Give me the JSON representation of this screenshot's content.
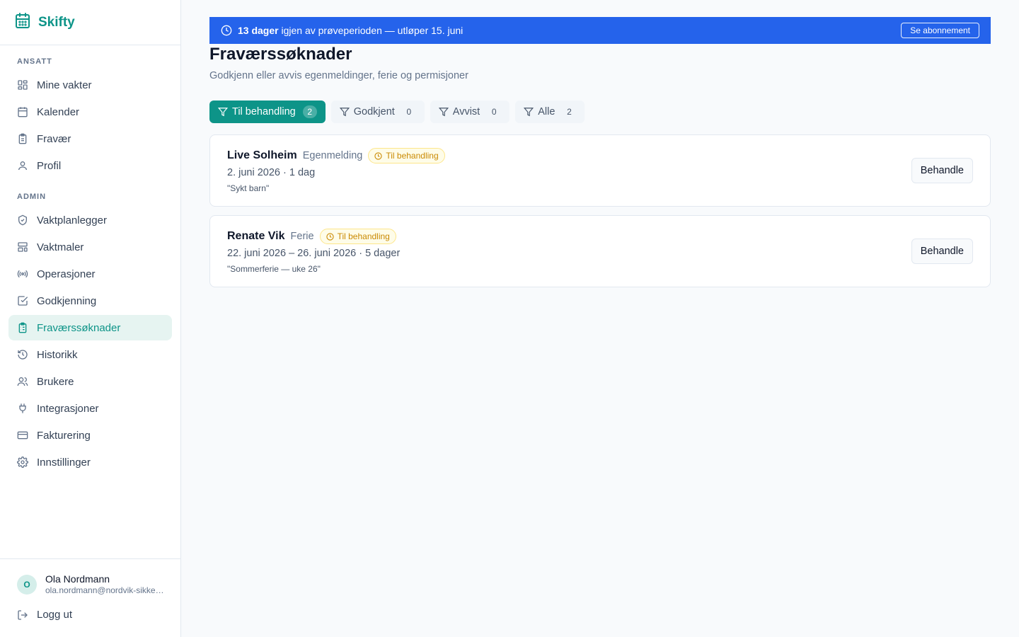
{
  "app": {
    "name": "Skifty"
  },
  "sidebar": {
    "ansatt_label": "ANSATT",
    "ansatt_items": [
      {
        "label": "Mine vakter",
        "icon": "layout-grid-icon"
      },
      {
        "label": "Kalender",
        "icon": "calendar-icon"
      },
      {
        "label": "Fravær",
        "icon": "clipboard-icon"
      },
      {
        "label": "Profil",
        "icon": "user-icon"
      }
    ],
    "admin_label": "ADMIN",
    "admin_items": [
      {
        "label": "Vaktplanlegger",
        "icon": "shield-icon"
      },
      {
        "label": "Vaktmaler",
        "icon": "template-icon"
      },
      {
        "label": "Operasjoner",
        "icon": "radio-icon"
      },
      {
        "label": "Godkjenning",
        "icon": "check-square-icon"
      },
      {
        "label": "Fraværssøknader",
        "icon": "clipboard-list-icon",
        "active": true
      },
      {
        "label": "Historikk",
        "icon": "history-icon"
      },
      {
        "label": "Brukere",
        "icon": "users-icon"
      },
      {
        "label": "Integrasjoner",
        "icon": "plug-icon"
      },
      {
        "label": "Fakturering",
        "icon": "credit-card-icon"
      },
      {
        "label": "Innstillinger",
        "icon": "gear-icon"
      }
    ],
    "user": {
      "initial": "O",
      "name": "Ola Nordmann",
      "email": "ola.nordmann@nordvik-sikkerhet.no"
    },
    "logout_label": "Logg ut"
  },
  "banner": {
    "strong": "13 dager",
    "text": "igjen av prøveperioden — utløper 15. juni",
    "button": "Se abonnement"
  },
  "page": {
    "title": "Fraværssøknader",
    "subtitle": "Godkjenn eller avvis egenmeldinger, ferie og permisjoner"
  },
  "filters": [
    {
      "label": "Til behandling",
      "count": "2",
      "active": true
    },
    {
      "label": "Godkjent",
      "count": "0"
    },
    {
      "label": "Avvist",
      "count": "0"
    },
    {
      "label": "Alle",
      "count": "2"
    }
  ],
  "requests": [
    {
      "name": "Live Solheim",
      "type": "Egenmelding",
      "status": "Til behandling",
      "dates": "2. juni 2026 · 1 dag",
      "note": "\"Sykt barn\"",
      "action": "Behandle"
    },
    {
      "name": "Renate Vik",
      "type": "Ferie",
      "status": "Til behandling",
      "dates": "22. juni 2026 – 26. juni 2026 · 5 dager",
      "note": "\"Sommerferie — uke 26\"",
      "action": "Behandle"
    }
  ],
  "colors": {
    "brand": "#0d9488",
    "banner": "#2563eb",
    "badge": "#ca8a04",
    "active_bg": "#e6f4f1"
  }
}
